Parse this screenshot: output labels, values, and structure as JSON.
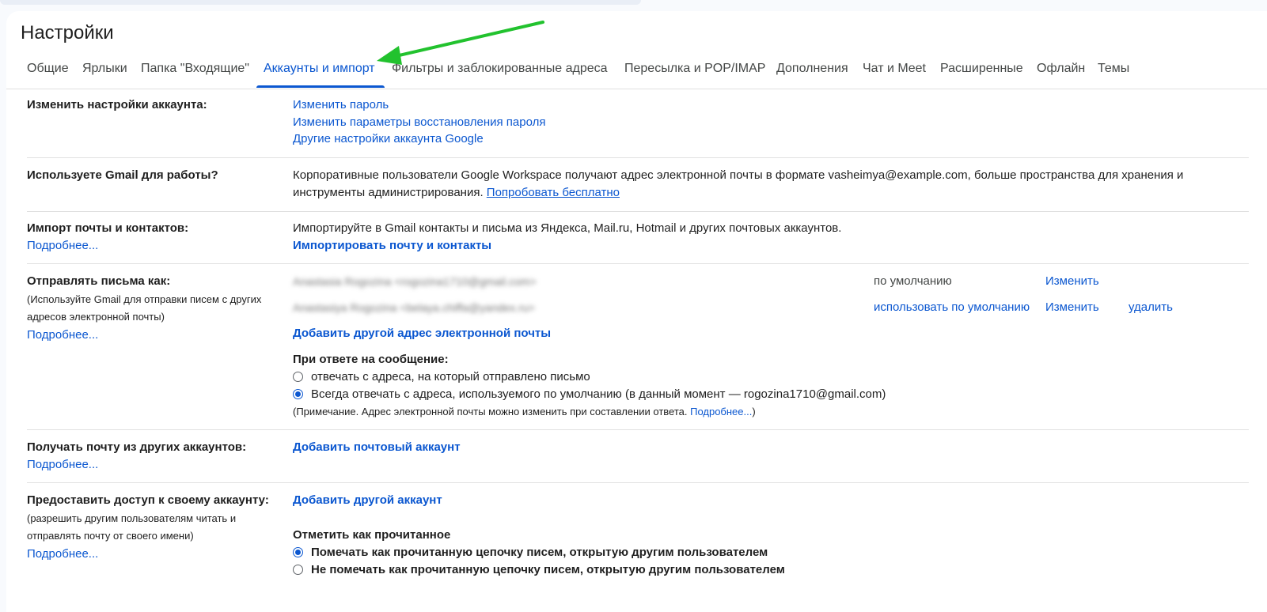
{
  "page_title": "Настройки",
  "tabs": [
    {
      "label": "Общие"
    },
    {
      "label": "Ярлыки"
    },
    {
      "label": "Папка \"Входящие\""
    },
    {
      "label": "Аккаунты и импорт"
    },
    {
      "label": "Фильтры и заблокированные адреса"
    },
    {
      "label": "Пересылка и POP/IMAP"
    },
    {
      "label": "Дополнения"
    },
    {
      "label": "Чат и Meet"
    },
    {
      "label": "Расширенные"
    },
    {
      "label": "Офлайн"
    },
    {
      "label": "Темы"
    }
  ],
  "active_tab": "Аккаунты и импорт",
  "colors": {
    "accent": "#0b57d0",
    "arrow": "#22c22e"
  },
  "account_settings": {
    "label": "Изменить настройки аккаунта:",
    "links": [
      "Изменить пароль",
      "Изменить параметры восстановления пароля",
      "Другие настройки аккаунта Google"
    ]
  },
  "workspace": {
    "label": "Используете Gmail для работы?",
    "text_line1": "Корпоративные пользователи Google Workspace получают адрес электронной почты в формате vasheimya@example.com, больше пространства для хранения и",
    "text_line2": "инструменты администрирования. ",
    "try_link": "Попробовать бесплатно"
  },
  "import": {
    "label": "Импорт почты и контактов:",
    "more": "Подробнее...",
    "text": "Импортируйте в Gmail контакты и письма из Яндекса, Mail.ru, Hotmail и других почтовых аккаунтов.",
    "action": "Импортировать почту и контакты"
  },
  "send_as": {
    "label": "Отправлять письма как:",
    "sub": "(Используйте Gmail для отправки писем с других адресов электронной почты)",
    "more": "Подробнее...",
    "addresses": [
      {
        "text": "Anastasia Rogozina <rogozina1710@gmail.com>",
        "status": "по умолчанию",
        "edit": "Изменить",
        "delete": ""
      },
      {
        "text": "Anastasiya Rogozina <belaya.chiffa@yandex.ru>",
        "status": "использовать по умолчанию",
        "edit": "Изменить",
        "delete": "удалить"
      }
    ],
    "add": "Добавить другой адрес электронной почты",
    "reply_heading": "При ответе на сообщение:",
    "reply_opt1": "отвечать с адреса, на который отправлено письмо",
    "reply_opt2": "Всегда отвечать с адреса, используемого по умолчанию (в данный момент — rogozina1710@gmail.com)",
    "reply_selected": 2,
    "note_text": "(Примечание. Адрес электронной почты можно изменить при составлении ответа. ",
    "note_link": "Подробнее...",
    "note_end": ")"
  },
  "receive": {
    "label": "Получать почту из других аккаунтов:",
    "more": "Подробнее...",
    "action": "Добавить почтовый аккаунт"
  },
  "grant": {
    "label": "Предоставить доступ к своему аккаунту:",
    "sub": "(разрешить другим пользователям читать и отправлять почту от своего имени)",
    "more": "Подробнее...",
    "action": "Добавить другой аккаунт",
    "mark_heading": "Отметить как прочитанное",
    "mark_opt1": "Помечать как прочитанную цепочку писем, открытую другим пользователем",
    "mark_opt2": "Не помечать как прочитанную цепочку писем, открытую другим пользователем",
    "mark_selected": 1
  }
}
